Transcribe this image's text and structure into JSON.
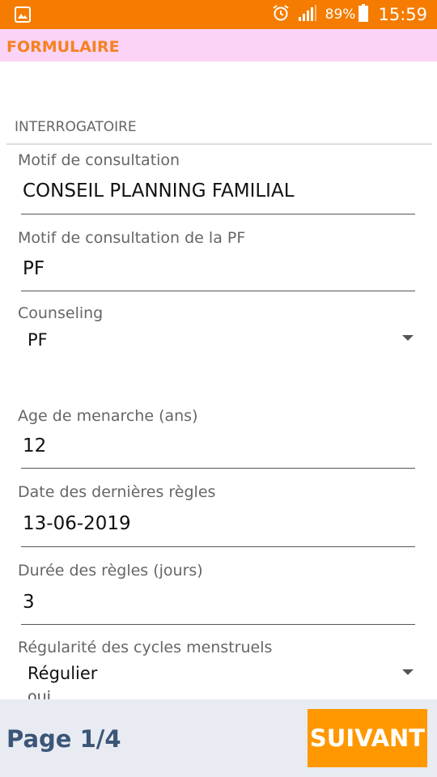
{
  "status_bar": {
    "battery_percent": "89%",
    "time": "15:59",
    "icons": [
      "image-icon",
      "alarm-icon",
      "signal-icon",
      "battery-icon"
    ],
    "color": "#f57c00"
  },
  "app_bar": {
    "title": "FORMULAIRE",
    "background": "#fbd3f6",
    "title_color": "#f5821f"
  },
  "form": {
    "section_title": "INTERROGATOIRE",
    "fields": [
      {
        "label": "Motif de consultation",
        "value": "CONSEIL PLANNING FAMILIAL"
      },
      {
        "label": "Motif de consultation de la PF",
        "value": "PF"
      },
      {
        "label": "Counseling",
        "value": "PF",
        "type": "dropdown"
      },
      {
        "label": "Age de menarche (ans)",
        "value": "12"
      },
      {
        "label": "Date des dernières règles",
        "value": "13-06-2019"
      },
      {
        "label": "Durée des règles (jours)",
        "value": "3"
      },
      {
        "label": "Régularité des cycles menstruels",
        "value": "Régulier",
        "type": "dropdown",
        "next_option_partial": "oui"
      }
    ]
  },
  "footer": {
    "page_indicator": "Page 1/4",
    "next_button": "SUIVANT",
    "button_color": "#ff9800"
  }
}
